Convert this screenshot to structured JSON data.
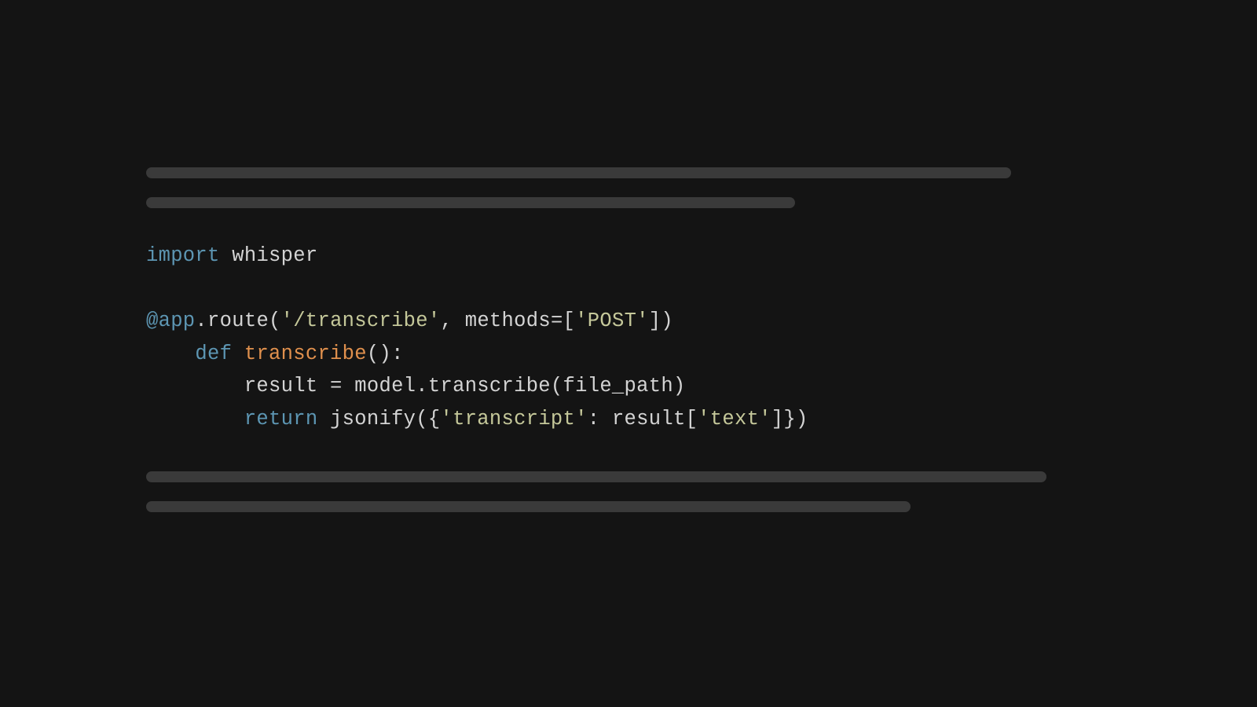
{
  "code": {
    "line1": {
      "import_kw": "import",
      "space": " ",
      "module": "whisper"
    },
    "line3": {
      "decorator_at": "@app",
      "dot": ".",
      "route": "route",
      "paren_open": "(",
      "route_str": "'/transcribe'",
      "comma": ", ",
      "methods_kw": "methods",
      "equals": "=",
      "bracket_open": "[",
      "post_str": "'POST'",
      "bracket_close": "]",
      "paren_close": ")"
    },
    "line4": {
      "indent": "    ",
      "def_kw": "def",
      "space": " ",
      "funcname": "transcribe",
      "parens": "():"
    },
    "line5": {
      "indent": "        ",
      "result": "result ",
      "equals": "= ",
      "call": "model.transcribe(file_path)"
    },
    "line6": {
      "indent": "        ",
      "return_kw": "return",
      "space": " ",
      "jsonify": "jsonify",
      "paren_open": "(",
      "brace_open": "{",
      "key_str": "'transcript'",
      "colon": ": ",
      "result_access": "result[",
      "text_str": "'text'",
      "close": "]})"
    }
  }
}
